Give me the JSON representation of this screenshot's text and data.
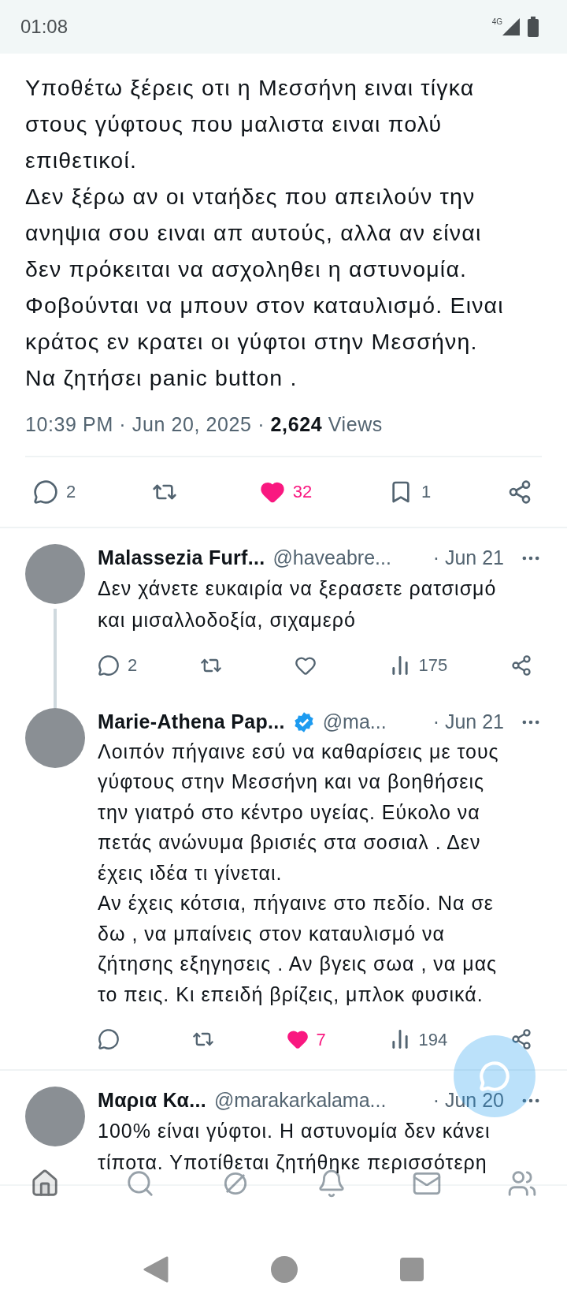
{
  "status_bar": {
    "time": "01:08",
    "network": "4G"
  },
  "tweet": {
    "text": "Υποθέτω ξέρεις οτι η Μεσσήνη ειναι τίγκα\nστους γύφτους που μαλιστα ειναι πολύ\nεπιθετικοί.\nΔεν ξέρω αν οι νταήδες που απειλούν την\nανηψια σου ειναι απ αυτούς, αλλα αν είναι\nδεν πρόκειται να ασχοληθει  η αστυνομία.\nΦοβούνται να μπουν στον καταυλισμό.  Ειναι\nκράτος εν κρατει οι γύφτοι στην Μεσσήνη.\nΝα ζητήσει panic button .",
    "timestamp": "10:39 PM · Jun 20, 2025 · ",
    "views_count": "2,624",
    "views_label": "Views",
    "actions": [
      {
        "kind": "reply",
        "count": "2"
      },
      {
        "kind": "repost"
      },
      {
        "kind": "like",
        "count": "32",
        "selected": true
      },
      {
        "kind": "bookmark",
        "count": "1",
        "selected": false
      },
      {
        "kind": "share"
      }
    ]
  },
  "replies": [
    {
      "name": "Malassezia Furf...",
      "verified": false,
      "handle": "@haveabre...",
      "date": "· Jun 21",
      "thread_line": true,
      "text": "Δεν χάνετε ευκαιρία να ξερασετε ρατσισμό\nκαι μισαλλοδοξία, σιχαμερό",
      "actions": [
        {
          "kind": "reply",
          "count": "2"
        },
        {
          "kind": "repost"
        },
        {
          "kind": "like",
          "selected": false
        },
        {
          "kind": "views",
          "count": "175"
        },
        {
          "kind": "share"
        }
      ]
    },
    {
      "name": "Marie-Athena Pap...",
      "verified": true,
      "handle": "@ma...",
      "date": "· Jun 21",
      "thread_line": false,
      "text": "Λοιπόν πήγαινε εσύ να καθαρίσεις με τους\nγύφτους στην Μεσσήνη και να βοηθήσεις\nτην γιατρό στο κέντρο υγείας.  Εύκολο να\nπετάς ανώνυμα βρισιές στα σοσιαλ . Δεν\nέχεις ιδέα τι γίνεται.\nΑν έχεις κότσια, πήγαινε στο πεδίο.   Να σε\nδω , να μπαίνεις στον καταυλισμό να\nζήτησης εξηγησεις .  Αν βγεις σωα ,  να μας\nτο πεις.   Κι επειδή βρίζεις,  μπλοκ φυσικά.",
      "actions": [
        {
          "kind": "reply"
        },
        {
          "kind": "repost"
        },
        {
          "kind": "like",
          "count": "7",
          "selected": true
        },
        {
          "kind": "views",
          "count": "194"
        },
        {
          "kind": "share"
        }
      ]
    },
    {
      "name": "Μαρια Κα...",
      "verified": false,
      "handle": "@marakarkalama...",
      "date": "· Jun 20",
      "thread_line": false,
      "text": "100% είναι γύφτοι. Η αστυνομία δεν κάνει\nτίποτα. Υποτίθεται ζητήθηκε περισσότερη"
    }
  ],
  "nav": [
    {
      "kind": "home",
      "selected": true
    },
    {
      "kind": "search",
      "selected": false
    },
    {
      "kind": "grok",
      "selected": false
    },
    {
      "kind": "notifications",
      "selected": false
    },
    {
      "kind": "messages",
      "selected": false
    },
    {
      "kind": "communities",
      "selected": false
    }
  ]
}
